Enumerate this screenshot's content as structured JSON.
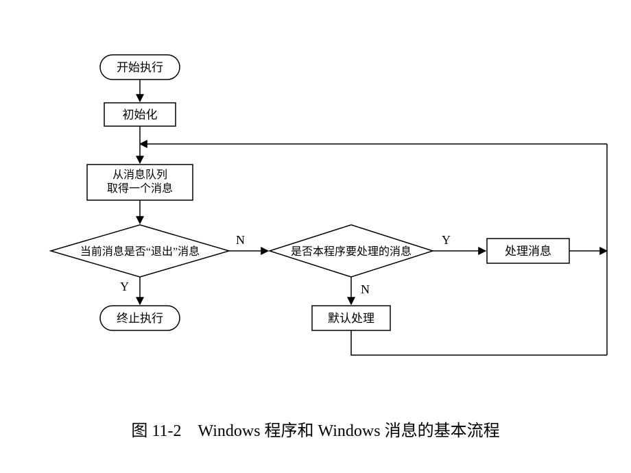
{
  "caption": "图 11-2　Windows 程序和 Windows 消息的基本流程",
  "nodes": {
    "start": "开始执行",
    "init": "初始化",
    "getmsg_line1": "从消息队列",
    "getmsg_line2": "取得一个消息",
    "is_quit": "当前消息是否“退出”消息",
    "terminate": "终止执行",
    "is_ours": "是否本程序要处理的消息",
    "process": "处理消息",
    "default": "默认处理"
  },
  "labels": {
    "Y": "Y",
    "N": "N"
  }
}
